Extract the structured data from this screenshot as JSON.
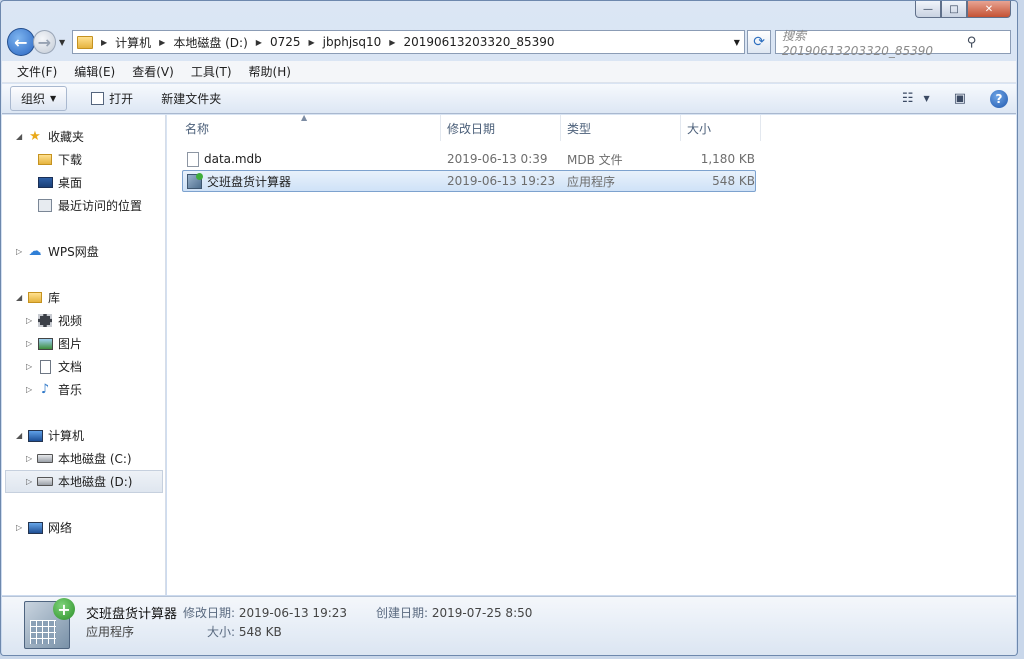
{
  "window": {
    "caption": {
      "minimize": "—",
      "maximize": "□",
      "close": "✕"
    }
  },
  "address": {
    "crumbs": [
      "计算机",
      "本地磁盘 (D:)",
      "0725",
      "jbphjsq10",
      "20190613203320_85390"
    ],
    "search_placeholder": "搜索 20190613203320_85390"
  },
  "menu": [
    "文件(F)",
    "编辑(E)",
    "查看(V)",
    "工具(T)",
    "帮助(H)"
  ],
  "toolbar": {
    "organize": "组织",
    "open": "打开",
    "new_folder": "新建文件夹"
  },
  "nav": {
    "favorites": "收藏夹",
    "downloads": "下载",
    "desktop": "桌面",
    "recent": "最近访问的位置",
    "wps": "WPS网盘",
    "libraries": "库",
    "videos": "视频",
    "pictures": "图片",
    "documents": "文档",
    "music": "音乐",
    "computer": "计算机",
    "drive_c": "本地磁盘 (C:)",
    "drive_d": "本地磁盘 (D:)",
    "network": "网络"
  },
  "columns": {
    "name": "名称",
    "date": "修改日期",
    "type": "类型",
    "size": "大小"
  },
  "files": [
    {
      "name": "data.mdb",
      "date": "2019-06-13 0:39",
      "type": "MDB 文件",
      "size": "1,180 KB"
    },
    {
      "name": "交班盘货计算器",
      "date": "2019-06-13 19:23",
      "type": "应用程序",
      "size": "548 KB"
    }
  ],
  "details": {
    "name": "交班盘货计算器",
    "kind": "应用程序",
    "modified_label": "修改日期:",
    "modified": "2019-06-13 19:23",
    "size_label": "大小:",
    "size": "548 KB",
    "created_label": "创建日期:",
    "created": "2019-07-25 8:50"
  }
}
